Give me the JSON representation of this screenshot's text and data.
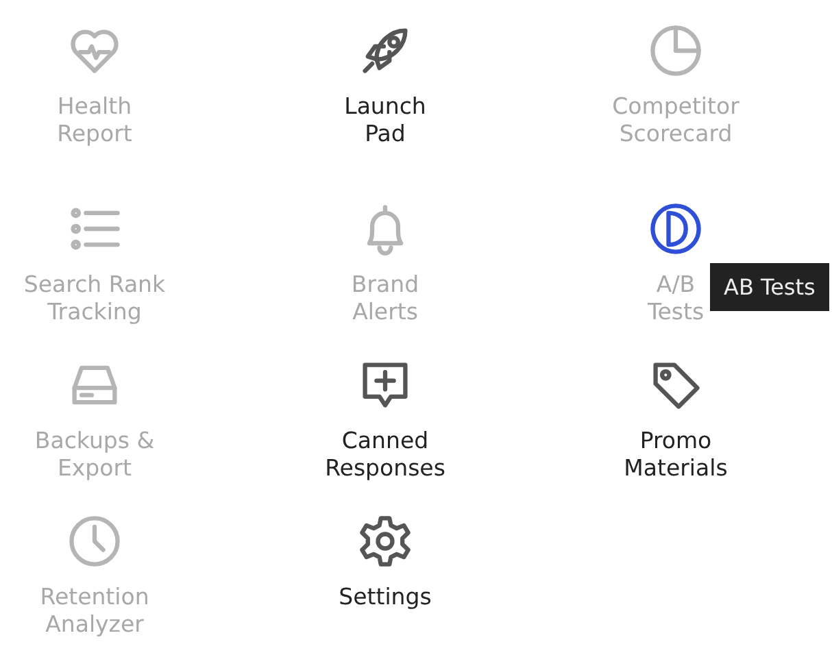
{
  "items": [
    {
      "label": "Health Report",
      "disabled": true,
      "hovered": false
    },
    {
      "label": "Launch Pad",
      "disabled": false,
      "hovered": false
    },
    {
      "label": "Competitor Scorecard",
      "disabled": true,
      "hovered": false
    },
    {
      "label": "Search Rank Tracking",
      "disabled": true,
      "hovered": false
    },
    {
      "label": "Brand Alerts",
      "disabled": true,
      "hovered": false
    },
    {
      "label": "A/B Tests",
      "disabled": true,
      "hovered": true
    },
    {
      "label": "Backups & Export",
      "disabled": true,
      "hovered": false
    },
    {
      "label": "Canned Responses",
      "disabled": false,
      "hovered": false
    },
    {
      "label": "Promo Materials",
      "disabled": false,
      "hovered": false
    },
    {
      "label": "Retention Analyzer",
      "disabled": true,
      "hovered": false
    },
    {
      "label": "Settings",
      "disabled": false,
      "hovered": false
    }
  ],
  "tooltip": {
    "text": "AB Tests"
  }
}
